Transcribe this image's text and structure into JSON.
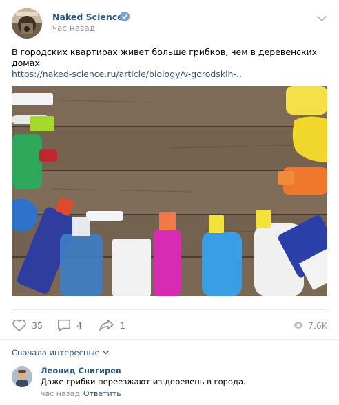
{
  "author": {
    "name": "Naked Science",
    "time": "час назад"
  },
  "post": {
    "text": "В городских квартирах живет больше грибков, чем в деревенских домах",
    "link": "https://naked-science.ru/article/biology/v-gorodskih-.."
  },
  "actions": {
    "likes": "35",
    "comments": "4",
    "shares": "1",
    "views": "7.6K"
  },
  "comments": {
    "sort_label": "Сначала интересные",
    "items": [
      {
        "author": "Леонид Снигирев",
        "text": "Даже грибки переезжают из деревень в города.",
        "time": "час назад",
        "reply": "Ответить"
      }
    ]
  },
  "colors": {
    "link": "#2a5885",
    "muted": "#939393",
    "verified": "#74a2d6"
  }
}
